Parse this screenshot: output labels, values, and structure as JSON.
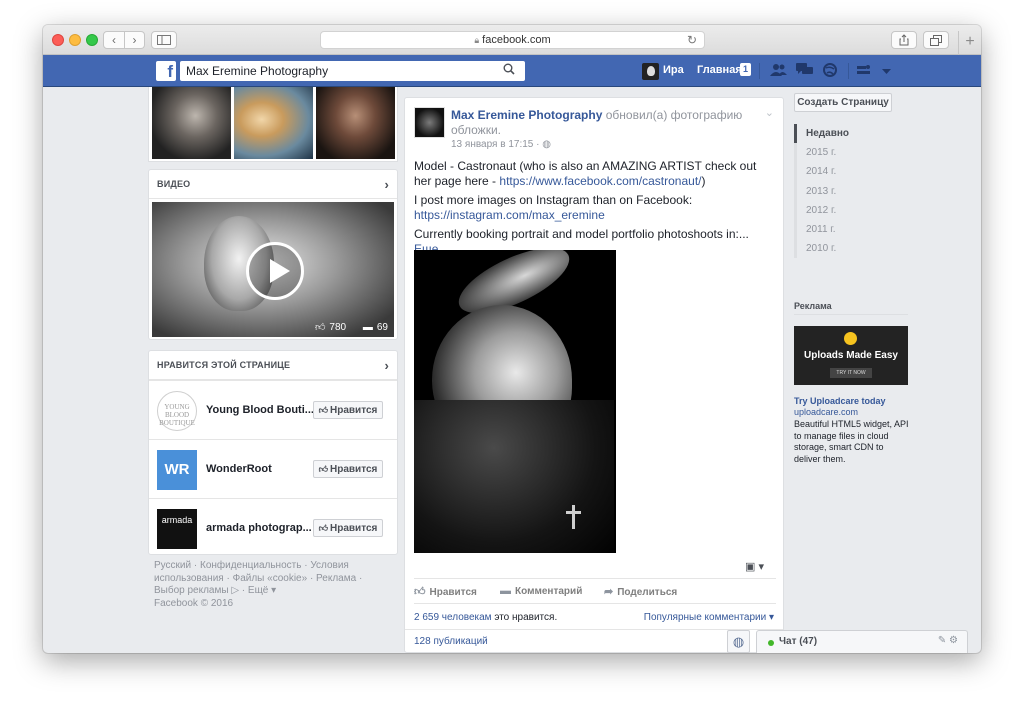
{
  "browser": {
    "url": "facebook.com",
    "back": "‹",
    "forward": "›",
    "new_tab": "+"
  },
  "fbbar": {
    "logo": "f",
    "search_value": "Max Eremine Photography",
    "user_name": "Ира",
    "home_label": "Главная",
    "home_badge": "1"
  },
  "left": {
    "video_header": "ВИДЕО",
    "video_likes": "780",
    "video_comments": "69",
    "likes_header": "НРАВИТСЯ ЭТОЙ СТРАНИЦЕ",
    "liked_pages": [
      {
        "name": "Young Blood Bouti...",
        "logo_text": "YOUNG BLOOD BOUTIQUE",
        "button": "Нравится"
      },
      {
        "name": "WonderRoot",
        "logo_text": "WR",
        "button": "Нравится"
      },
      {
        "name": "armada photograp...",
        "logo_text": "armada",
        "button": "Нравится"
      }
    ],
    "footer": "Русский · Конфиденциальность · Условия использования · Файлы «cookie» · Реклама · Выбор рекламы ▷ · Ещё ▾",
    "copyright": "Facebook © 2016"
  },
  "post": {
    "author": "Max Eremine Photography",
    "action": "обновил(а) фотографию обложки.",
    "time": "13 января в 17:15 · ◍",
    "line1": "Model - Castronaut (who is also an AMAZING ARTIST check out her page here - ",
    "link1": "https://www.facebook.com/castronaut/",
    "line1_end": ")",
    "line2": "I post more images on Instagram than on Facebook: ",
    "link2": "https://instagram.com/max_eremine",
    "line3": "Currently booking portrait and model portfolio photoshoots in:... ",
    "more": "Еще",
    "action_like": "Нравится",
    "action_comment": "Комментарий",
    "action_share": "Поделиться",
    "likes_count": "2 659 человекам",
    "likes_suffix": " это нравится.",
    "popular_comments": "Популярные комментарии ▾",
    "shares": "128 публикаций"
  },
  "right": {
    "create_page": "Создать Страницу",
    "years": [
      "Недавно",
      "2015 г.",
      "2014 г.",
      "2013 г.",
      "2012 г.",
      "2011 г.",
      "2010 г."
    ],
    "ads_label": "Реклама",
    "ad_image_title": "Uploads Made Easy",
    "ad_image_button": "TRY IT NOW",
    "ad_title": "Try Uploadcare today",
    "ad_domain": "uploadcare.com",
    "ad_desc": "Beautiful HTML5 widget, API to manage files in cloud storage, smart CDN to deliver them."
  },
  "chat": {
    "label": "Чат (47)",
    "tools": "✎ ⚙"
  },
  "colors": {
    "fb_blue": "#4267b2",
    "link": "#365899",
    "background": "#e9ebee"
  }
}
